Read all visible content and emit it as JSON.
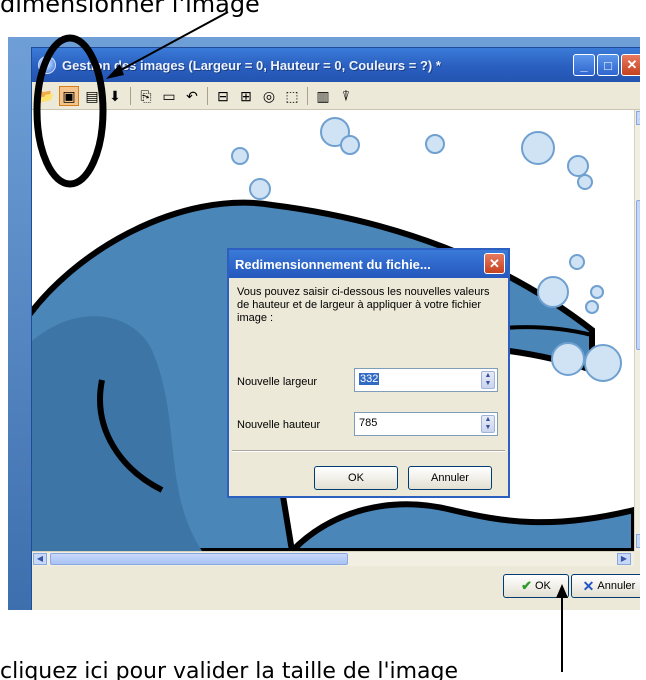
{
  "annotation": {
    "top_caption": "dimensionner l'image",
    "bottom_caption": "cliquez ici pour valider la taille de l'image"
  },
  "window": {
    "title": "Gestion des images  (Largeur = 0, Hauteur = 0, Couleurs = ?) *",
    "buttons": {
      "minimize": "_",
      "maximize": "□",
      "close": "✕"
    }
  },
  "toolbar": {
    "icons": [
      "open-icon",
      "resize-icon",
      "rotate-icon",
      "paint-icon",
      "copy-icon",
      "paste-icon",
      "undo-icon",
      "crop-icon",
      "flip-icon",
      "effects-icon",
      "select-icon",
      "properties-icon",
      "filter-icon"
    ]
  },
  "dialog": {
    "title": "Redimensionnement du fichie...",
    "message": "Vous pouvez saisir ci-dessous les nouvelles valeurs de hauteur et de largeur à appliquer à votre fichier image :",
    "width_label": "Nouvelle largeur",
    "width_value": "332",
    "height_label": "Nouvelle hauteur",
    "height_value": "785",
    "ok_label": "OK",
    "cancel_label": "Annuler"
  },
  "statusbar": {
    "ok_label": "OK",
    "cancel_label": "Annuler"
  },
  "colors": {
    "title_blue": "#2a5fc0",
    "image_fill": "#4a86b8",
    "image_outline": "#000000",
    "bubble": "#9ec6ea"
  }
}
